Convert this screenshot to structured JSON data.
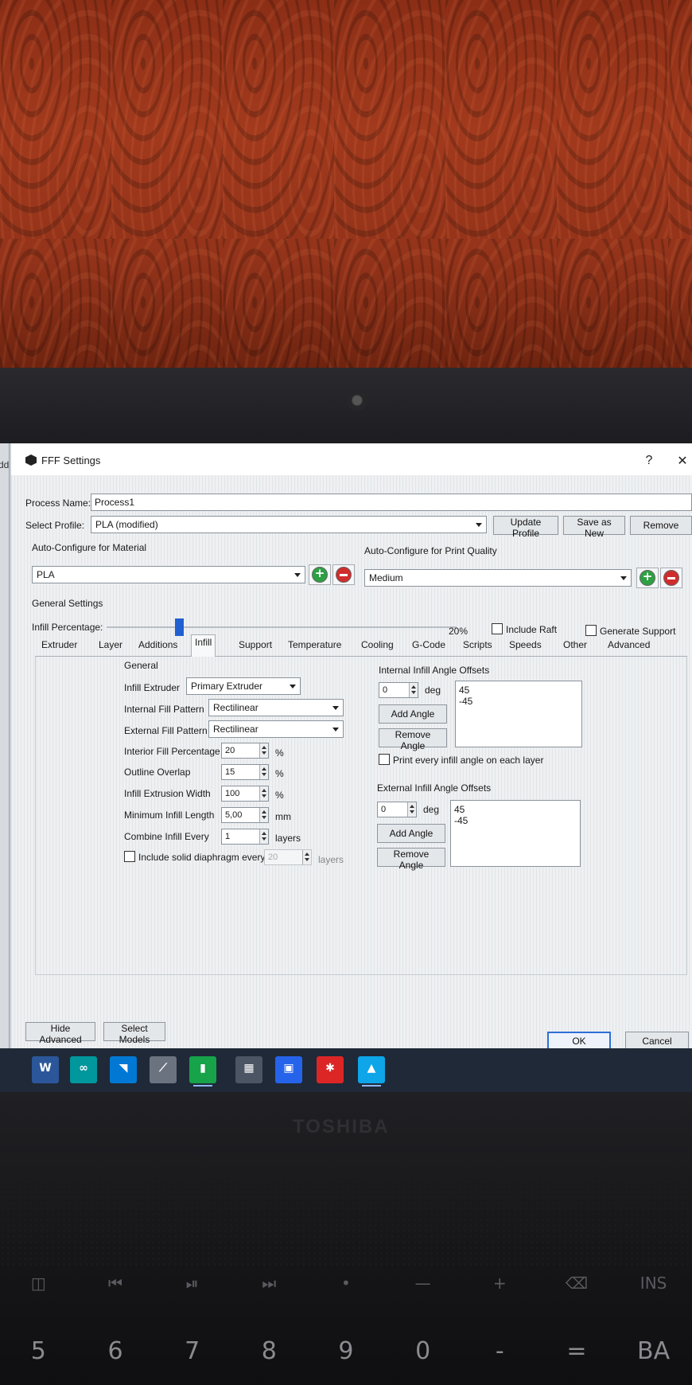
{
  "window": {
    "title": "FFF Settings",
    "help_label": "?",
    "close_label": "✕",
    "left_edge_text": "dd"
  },
  "process": {
    "name_label": "Process Name:",
    "name_value": "Process1"
  },
  "profile": {
    "label": "Select Profile:",
    "selected": "PLA (modified)",
    "update_label": "Update Profile",
    "save_as_new_label": "Save as New",
    "remove_label": "Remove"
  },
  "material": {
    "label": "Auto-Configure for Material",
    "selected": "PLA"
  },
  "quality": {
    "label": "Auto-Configure for Print Quality",
    "selected": "Medium"
  },
  "general_settings": {
    "heading": "General Settings",
    "infill_label": "Infill Percentage:",
    "infill_value": "20%",
    "infill_fraction": 0.2,
    "include_raft_label": "Include Raft",
    "include_raft_checked": false,
    "generate_support_label": "Generate Support",
    "generate_support_checked": false
  },
  "tabs": [
    "Extruder",
    "Layer",
    "Additions",
    "Infill",
    "Support",
    "Temperature",
    "Cooling",
    "G-Code",
    "Scripts",
    "Speeds",
    "Other",
    "Advanced"
  ],
  "active_tab": "Infill",
  "infill": {
    "general_heading": "General",
    "extruder_label": "Infill Extruder",
    "extruder_value": "Primary Extruder",
    "internal_pattern_label": "Internal Fill Pattern",
    "internal_pattern_value": "Rectilinear",
    "external_pattern_label": "External Fill Pattern",
    "external_pattern_value": "Rectilinear",
    "interior_pct_label": "Interior Fill Percentage",
    "interior_pct_value": "20",
    "outline_overlap_label": "Outline Overlap",
    "outline_overlap_value": "15",
    "extrusion_width_label": "Infill Extrusion Width",
    "extrusion_width_value": "100",
    "min_length_label": "Minimum Infill Length",
    "min_length_value": "5,00",
    "combine_label": "Combine Infill Every",
    "combine_value": "1",
    "diaphragm_label": "Include solid diaphragm every",
    "diaphragm_value": "20",
    "diaphragm_checked": false,
    "unit_pct": "%",
    "unit_mm": "mm",
    "unit_layers": "layers"
  },
  "internal_angles": {
    "heading": "Internal Infill Angle Offsets",
    "input_value": "0",
    "unit": "deg",
    "add_label": "Add Angle",
    "remove_label": "Remove Angle",
    "list": [
      "45",
      "-45"
    ],
    "print_every_label": "Print every infill angle on each layer",
    "print_every_checked": false
  },
  "external_angles": {
    "heading": "External Infill Angle Offsets",
    "input_value": "0",
    "unit": "deg",
    "add_label": "Add Angle",
    "remove_label": "Remove Angle",
    "list": [
      "45",
      "-45"
    ]
  },
  "footer": {
    "hide_advanced_label": "Hide Advanced",
    "select_models_label": "Select Models",
    "ok_label": "OK",
    "cancel_label": "Cancel"
  },
  "taskbar": [
    {
      "icon": "word-icon",
      "glyph": "W",
      "color": "#2b579a",
      "active": false
    },
    {
      "icon": "arduino-icon",
      "glyph": "∞",
      "color": "#00979d",
      "active": false
    },
    {
      "icon": "vscode-icon",
      "glyph": "◥",
      "color": "#0078d4",
      "active": false
    },
    {
      "icon": "app-icon-4",
      "glyph": "⟋",
      "color": "#6b7280",
      "active": false
    },
    {
      "icon": "simplify3d-icon",
      "glyph": "▮",
      "color": "#16a34a",
      "active": true
    },
    {
      "icon": "calculator-icon",
      "glyph": "▦",
      "color": "#4b5563",
      "active": false
    },
    {
      "icon": "window-icon",
      "glyph": "▣",
      "color": "#2563eb",
      "active": false
    },
    {
      "icon": "app-icon-8",
      "glyph": "✱",
      "color": "#dc2626",
      "active": false
    },
    {
      "icon": "photos-icon",
      "glyph": "▲",
      "color": "#0ea5e9",
      "active": true
    }
  ],
  "laptop": {
    "brand": "TOSHIBA",
    "keys_top": [
      "◫",
      "⏮",
      "⏯",
      "⏭",
      "•",
      "—",
      "+",
      "⌫",
      "INS"
    ],
    "keys_nums": [
      "5",
      "6",
      "7",
      "8",
      "9",
      "0",
      "-",
      "=",
      "BA"
    ]
  }
}
